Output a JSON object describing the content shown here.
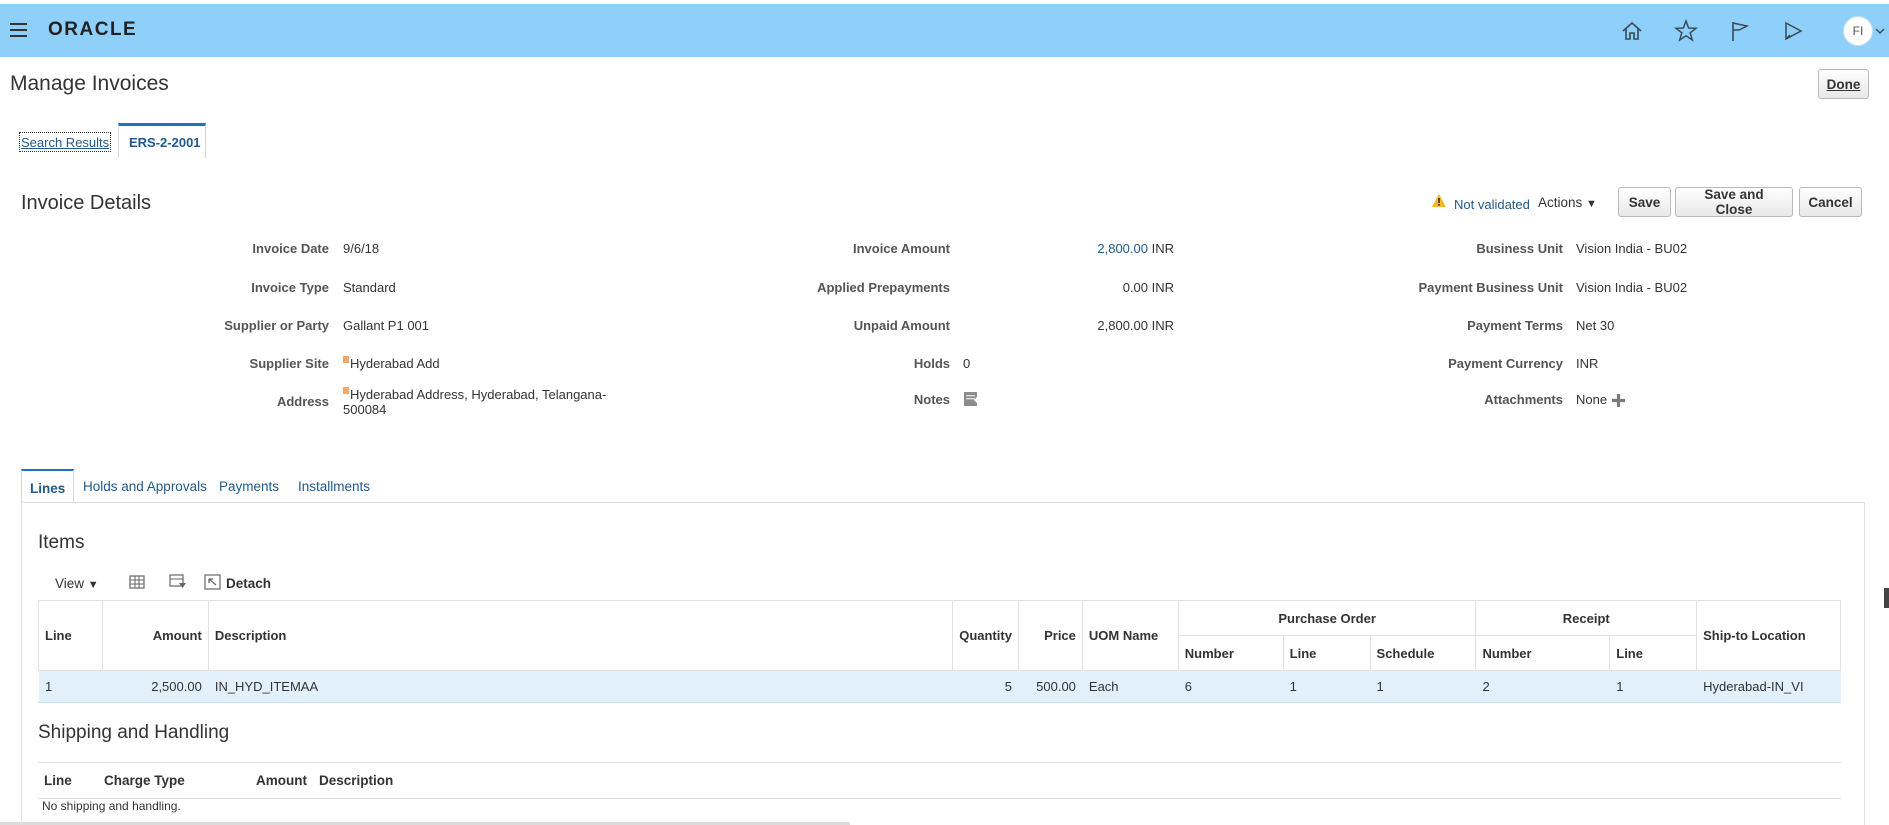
{
  "header": {
    "logo": "ORACLE",
    "avatar_initials": "FI",
    "icons": [
      "menu-icon",
      "home-icon",
      "star-icon",
      "flag-icon",
      "notifications-icon"
    ]
  },
  "page": {
    "title": "Manage Invoices",
    "done_label": "Done"
  },
  "doc_tabs": {
    "search_results": "Search Results",
    "current": "ERS-2-2001"
  },
  "invoice": {
    "section_title": "Invoice Details",
    "status": "Not validated",
    "actions_label": "Actions",
    "save_label": "Save",
    "save_close_label": "Save and Close",
    "cancel_label": "Cancel",
    "fields": {
      "invoice_date": {
        "label": "Invoice Date",
        "value": "9/6/18"
      },
      "invoice_type": {
        "label": "Invoice Type",
        "value": "Standard"
      },
      "supplier": {
        "label": "Supplier or Party",
        "value": "Gallant P1 001"
      },
      "supplier_site": {
        "label": "Supplier Site",
        "value": "Hyderabad Add"
      },
      "address": {
        "label": "Address",
        "value_line1": "Hyderabad Address, Hyderabad, Telangana-",
        "value_line2": "500084"
      },
      "invoice_amount": {
        "label": "Invoice Amount",
        "value": "2,800.00",
        "currency": "INR"
      },
      "applied_prepayments": {
        "label": "Applied Prepayments",
        "value": "0.00 INR"
      },
      "unpaid_amount": {
        "label": "Unpaid Amount",
        "value": "2,800.00 INR"
      },
      "holds": {
        "label": "Holds",
        "value": "0"
      },
      "notes": {
        "label": "Notes"
      },
      "business_unit": {
        "label": "Business Unit",
        "value": "Vision India - BU02"
      },
      "payment_business_unit": {
        "label": "Payment Business Unit",
        "value": "Vision India - BU02"
      },
      "payment_terms": {
        "label": "Payment Terms",
        "value": "Net 30"
      },
      "payment_currency": {
        "label": "Payment Currency",
        "value": "INR"
      },
      "attachments": {
        "label": "Attachments",
        "value": "None"
      }
    }
  },
  "subtabs": [
    "Lines",
    "Holds and Approvals",
    "Payments",
    "Installments"
  ],
  "items": {
    "title": "Items",
    "view_label": "View",
    "detach_label": "Detach",
    "columns": {
      "line": "Line",
      "amount": "Amount",
      "description": "Description",
      "quantity": "Quantity",
      "price": "Price",
      "uom": "UOM Name",
      "po_group": "Purchase Order",
      "po_number": "Number",
      "po_line": "Line",
      "po_schedule": "Schedule",
      "receipt_group": "Receipt",
      "rcpt_number": "Number",
      "rcpt_line": "Line",
      "ship_to": "Ship-to Location"
    },
    "rows": [
      {
        "line": "1",
        "amount": "2,500.00",
        "description": "IN_HYD_ITEMAA",
        "quantity": "5",
        "price": "500.00",
        "uom": "Each",
        "po_number": "6",
        "po_line": "1",
        "po_schedule": "1",
        "rcpt_number": "2",
        "rcpt_line": "1",
        "ship_to": "Hyderabad-IN_VI"
      }
    ]
  },
  "shipping": {
    "title": "Shipping and Handling",
    "columns": {
      "line": "Line",
      "charge_type": "Charge Type",
      "amount": "Amount",
      "description": "Description"
    },
    "empty_text": "No shipping and handling."
  },
  "colors": {
    "header_bg": "#8fd0fb",
    "link": "#205a8c",
    "selected_row": "#e1f0fb",
    "warning": "#f2b823"
  }
}
